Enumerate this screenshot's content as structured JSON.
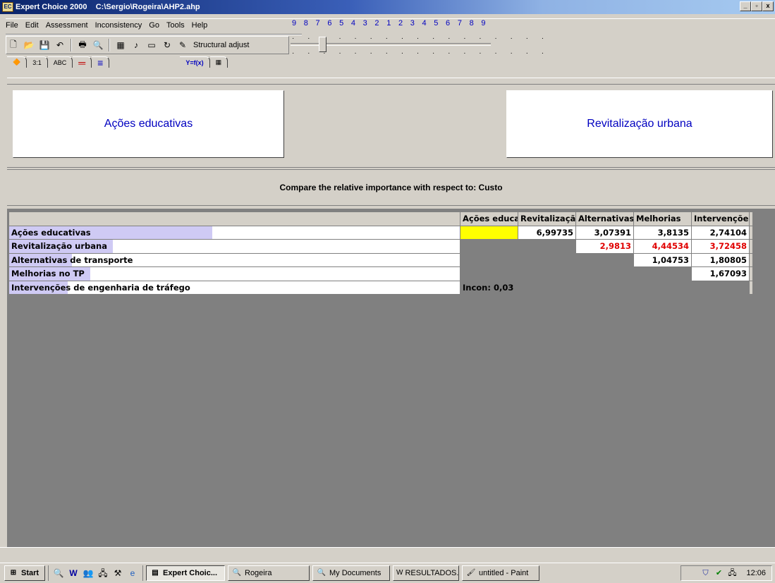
{
  "window": {
    "app_name": "Expert Choice 2000",
    "file_path": "C:\\Sergio\\Rogeira\\AHP2.ahp",
    "min_label": "_",
    "max_label": " ̅",
    "close_label": "x"
  },
  "menu": {
    "file": "File",
    "edit": "Edit",
    "assessment": "Assessment",
    "inconsistency": "Inconsistency",
    "go": "Go",
    "tools": "Tools",
    "help": "Help"
  },
  "toolbar": {
    "structural_adjust": "Structural adjust"
  },
  "mode_tabs": {
    "numerical": "3:1",
    "verbal": "ABC",
    "graphical": "═",
    "questionnaire": "≡",
    "formula": "Y=f(x)"
  },
  "comparison": {
    "left_element": "Ações educativas",
    "right_element": "Revitalização urbana",
    "scale_numbers": "9 8 7 6 5 4 3 2 1 2 3 4 5 6 7 8 9",
    "respect_text": "Compare the relative importance  with respect to: Custo"
  },
  "matrix": {
    "columns": [
      "Ações educativas",
      "Revitalização urbana",
      "Alternativas de transporte",
      "Melhorias",
      "Intervenções"
    ],
    "rows": [
      {
        "label": "Ações educativas",
        "cells": [
          "",
          "6,99735",
          "3,07391",
          "3,8135",
          "2,74104"
        ],
        "priority_pct": 45
      },
      {
        "label": "Revitalização urbana",
        "cells": [
          "",
          "",
          "2,9813",
          "4,44534",
          "3,72458"
        ],
        "priority_pct": 23
      },
      {
        "label": "Alternativas de transporte",
        "cells": [
          "",
          "",
          "",
          "1,04753",
          "1,80805"
        ],
        "priority_pct": 14
      },
      {
        "label": "Melhorias no TP",
        "cells": [
          "",
          "",
          "",
          "",
          "1,67093"
        ],
        "priority_pct": 18
      },
      {
        "label": "Intervenções de engenharia de tráfego",
        "cells": [
          "Incon: 0,03",
          "",
          "",
          "",
          ""
        ],
        "priority_pct": 13
      }
    ],
    "red_color": "#e00000",
    "highlight_color": "#ffff00"
  },
  "taskbar": {
    "start": "Start",
    "buttons": [
      "Expert Choic...",
      "Rogeira",
      "My Documents",
      "RESULTADOS....",
      "untitled - Paint"
    ],
    "clock": "12:06"
  }
}
